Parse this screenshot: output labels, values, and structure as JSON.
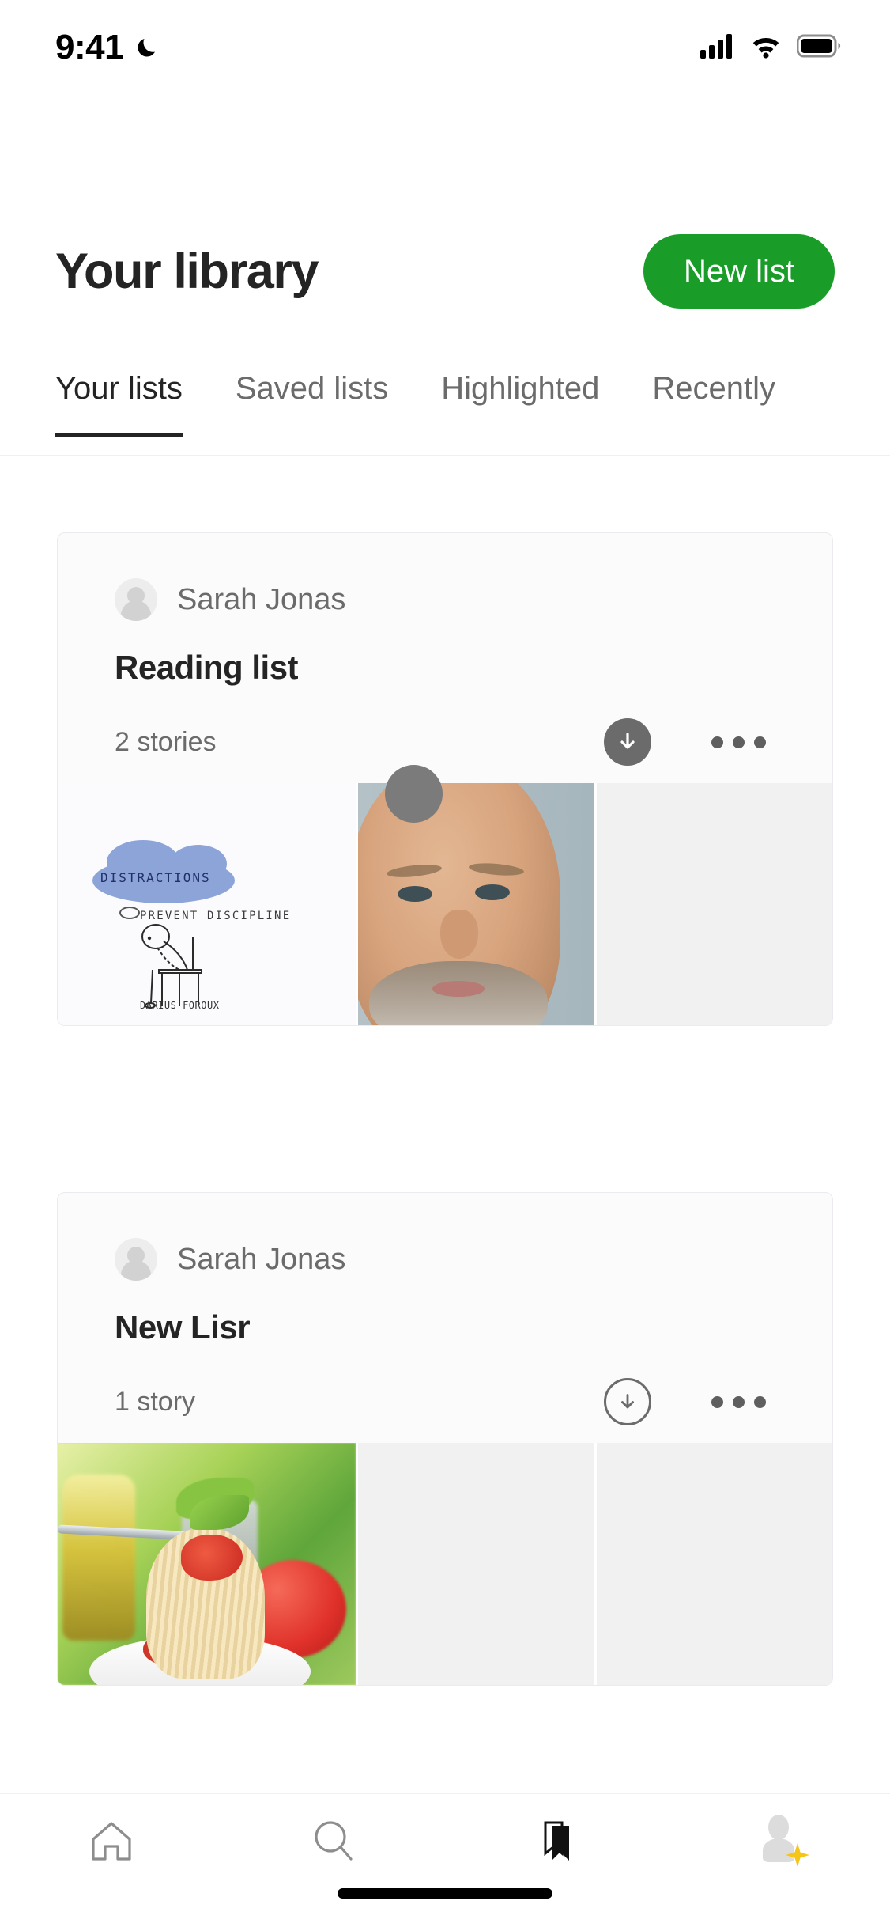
{
  "status_bar": {
    "time": "9:41",
    "dnd_icon": "moon-icon",
    "signal_icon": "cellular-signal-icon",
    "wifi_icon": "wifi-icon",
    "battery_icon": "battery-full-icon"
  },
  "header": {
    "title": "Your library",
    "new_list_label": "New list",
    "accent_color": "#1a9c29"
  },
  "tabs": [
    {
      "label": "Your lists",
      "active": true
    },
    {
      "label": "Saved lists",
      "active": false
    },
    {
      "label": "Highlighted",
      "active": false
    },
    {
      "label": "Recently",
      "active": false
    }
  ],
  "lists": [
    {
      "author": "Sarah Jonas",
      "title": "Reading list",
      "story_count": "2 stories",
      "download_icon": "download-circle-filled-icon",
      "more_icon": "more-horizontal-icon",
      "thumbnails": [
        {
          "kind": "illustration",
          "cloud_text": "DISTRACTIONS",
          "sub_text": "PREVENT DISCIPLINE",
          "signature": "DARIUS FOROUX"
        },
        {
          "kind": "photo",
          "alt": "close-up portrait of bearded man"
        },
        {
          "kind": "empty",
          "alt": ""
        }
      ]
    },
    {
      "author": "Sarah Jonas",
      "title": "New Lisr",
      "story_count": "1 story",
      "download_icon": "download-circle-outline-icon",
      "more_icon": "more-horizontal-icon",
      "thumbnails": [
        {
          "kind": "photo",
          "alt": "spaghetti pasta with tomato on fork"
        },
        {
          "kind": "empty",
          "alt": ""
        },
        {
          "kind": "empty",
          "alt": ""
        }
      ]
    }
  ],
  "bottom_nav": [
    {
      "icon": "home-icon",
      "active": false
    },
    {
      "icon": "search-icon",
      "active": false
    },
    {
      "icon": "bookmark-icon",
      "active": true
    },
    {
      "icon": "profile-avatar-icon",
      "active": false,
      "badge": "sparkle-star-icon",
      "badge_color": "#f5c518"
    }
  ]
}
